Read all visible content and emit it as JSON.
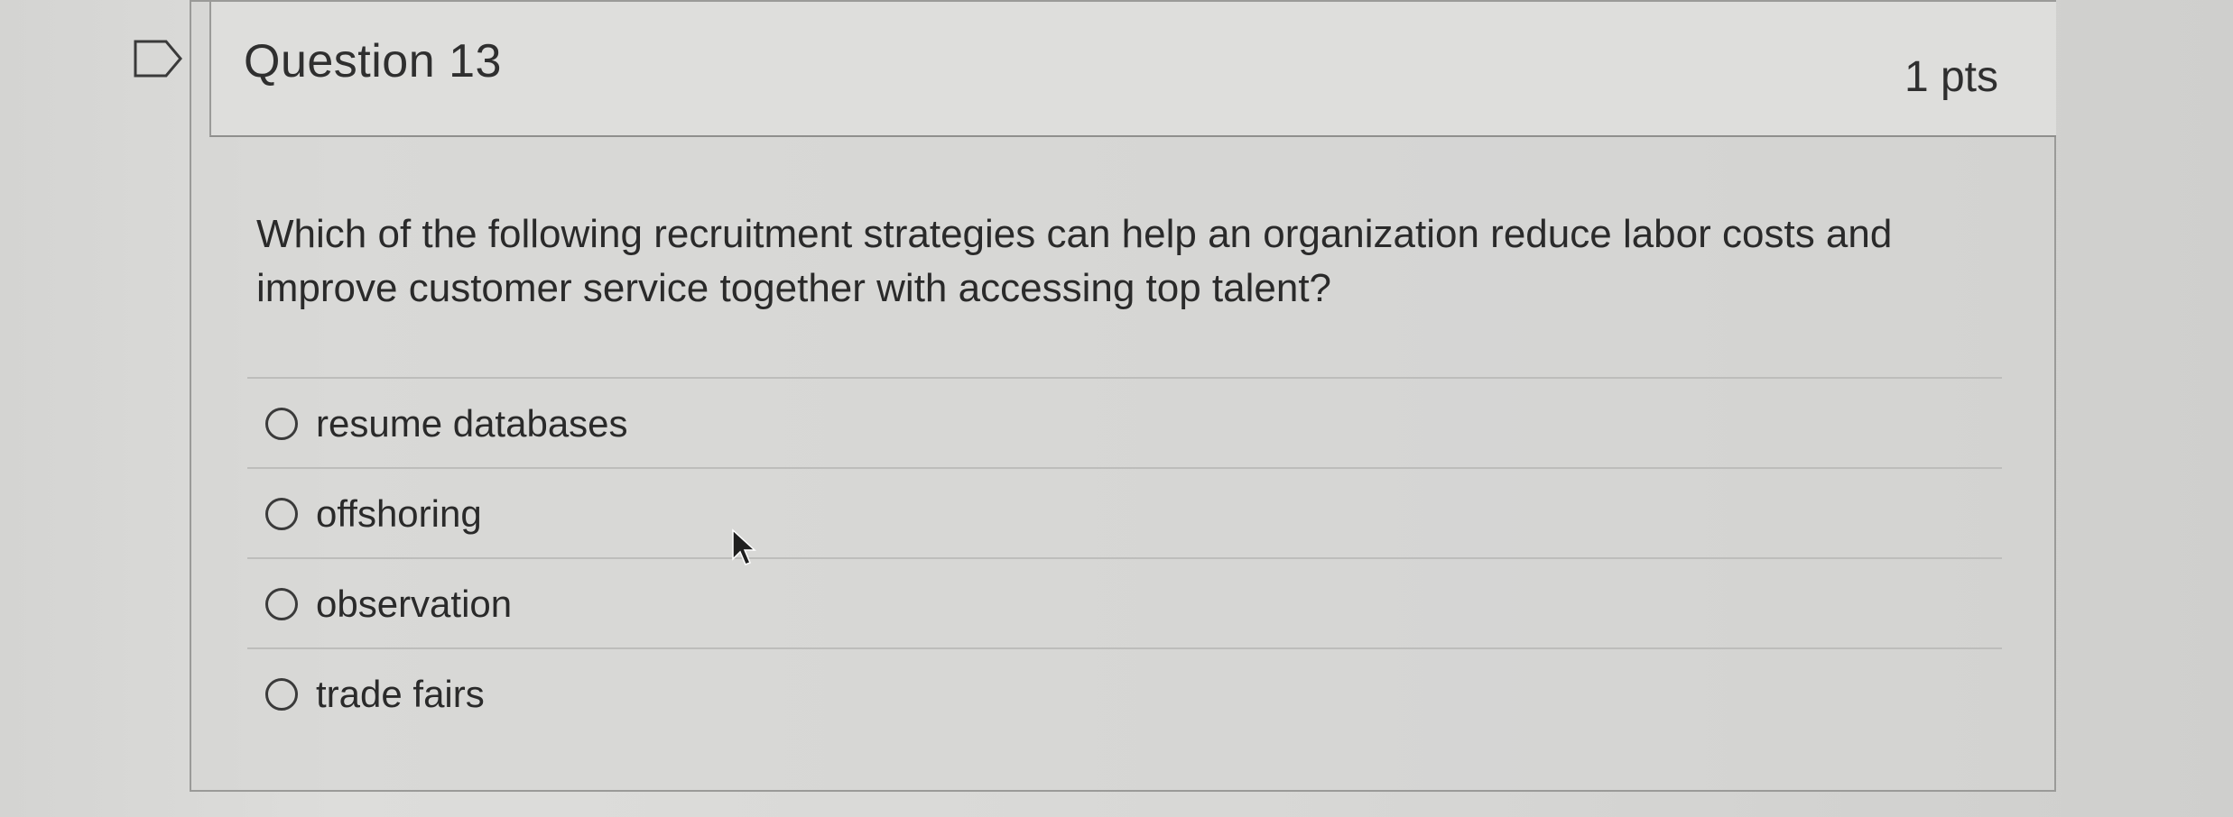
{
  "question": {
    "title": "Question 13",
    "points": "1 pts",
    "text": "Which of the following recruitment strategies can help an organization reduce labor costs and improve customer service together with accessing top talent?",
    "answers": [
      {
        "label": "resume databases",
        "selected": false
      },
      {
        "label": "offshoring",
        "selected": false
      },
      {
        "label": "observation",
        "selected": false
      },
      {
        "label": "trade fairs",
        "selected": false
      }
    ]
  },
  "icons": {
    "flag": "flag-icon",
    "radio": "radio-icon",
    "cursor": "mouse-pointer-icon"
  },
  "colors": {
    "background": "#dcdcda",
    "text": "#2a2a2a",
    "border": "#9a9a98"
  }
}
